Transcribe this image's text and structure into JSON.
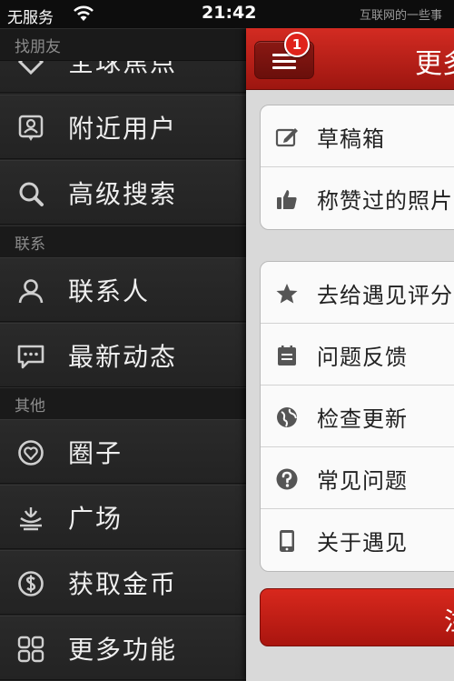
{
  "status_bar": {
    "carrier": "无服务",
    "time": "21:42",
    "watermark": "互联网的一些事"
  },
  "drawer": {
    "sections": [
      {
        "label": "找朋友"
      },
      {
        "label": "联系"
      },
      {
        "label": "其他"
      }
    ],
    "items": [
      {
        "label": "全球焦点",
        "icon": "globe-focus-icon"
      },
      {
        "label": "附近用户",
        "icon": "nearby-user-icon"
      },
      {
        "label": "高级搜索",
        "icon": "search-icon"
      },
      {
        "label": "联系人",
        "icon": "contact-person-icon"
      },
      {
        "label": "最新动态",
        "icon": "chat-bubble-icon"
      },
      {
        "label": "圈子",
        "icon": "circle-icon"
      },
      {
        "label": "广场",
        "icon": "fountain-icon"
      },
      {
        "label": "获取金币",
        "icon": "coin-icon"
      },
      {
        "label": "更多功能",
        "icon": "grid-icon"
      }
    ]
  },
  "panel": {
    "title": "更多",
    "menu_badge": "1",
    "group1": [
      {
        "label": "草稿箱",
        "icon": "draft-edit-icon"
      },
      {
        "label": "称赞过的照片",
        "icon": "thumbs-up-icon"
      }
    ],
    "group2": [
      {
        "label": "去给遇见评分",
        "icon": "star-icon"
      },
      {
        "label": "问题反馈",
        "icon": "notepad-icon"
      },
      {
        "label": "检查更新",
        "icon": "globe-icon"
      },
      {
        "label": "常见问题",
        "icon": "question-icon"
      },
      {
        "label": "关于遇见",
        "icon": "phone-icon"
      }
    ],
    "button_label": "注"
  }
}
